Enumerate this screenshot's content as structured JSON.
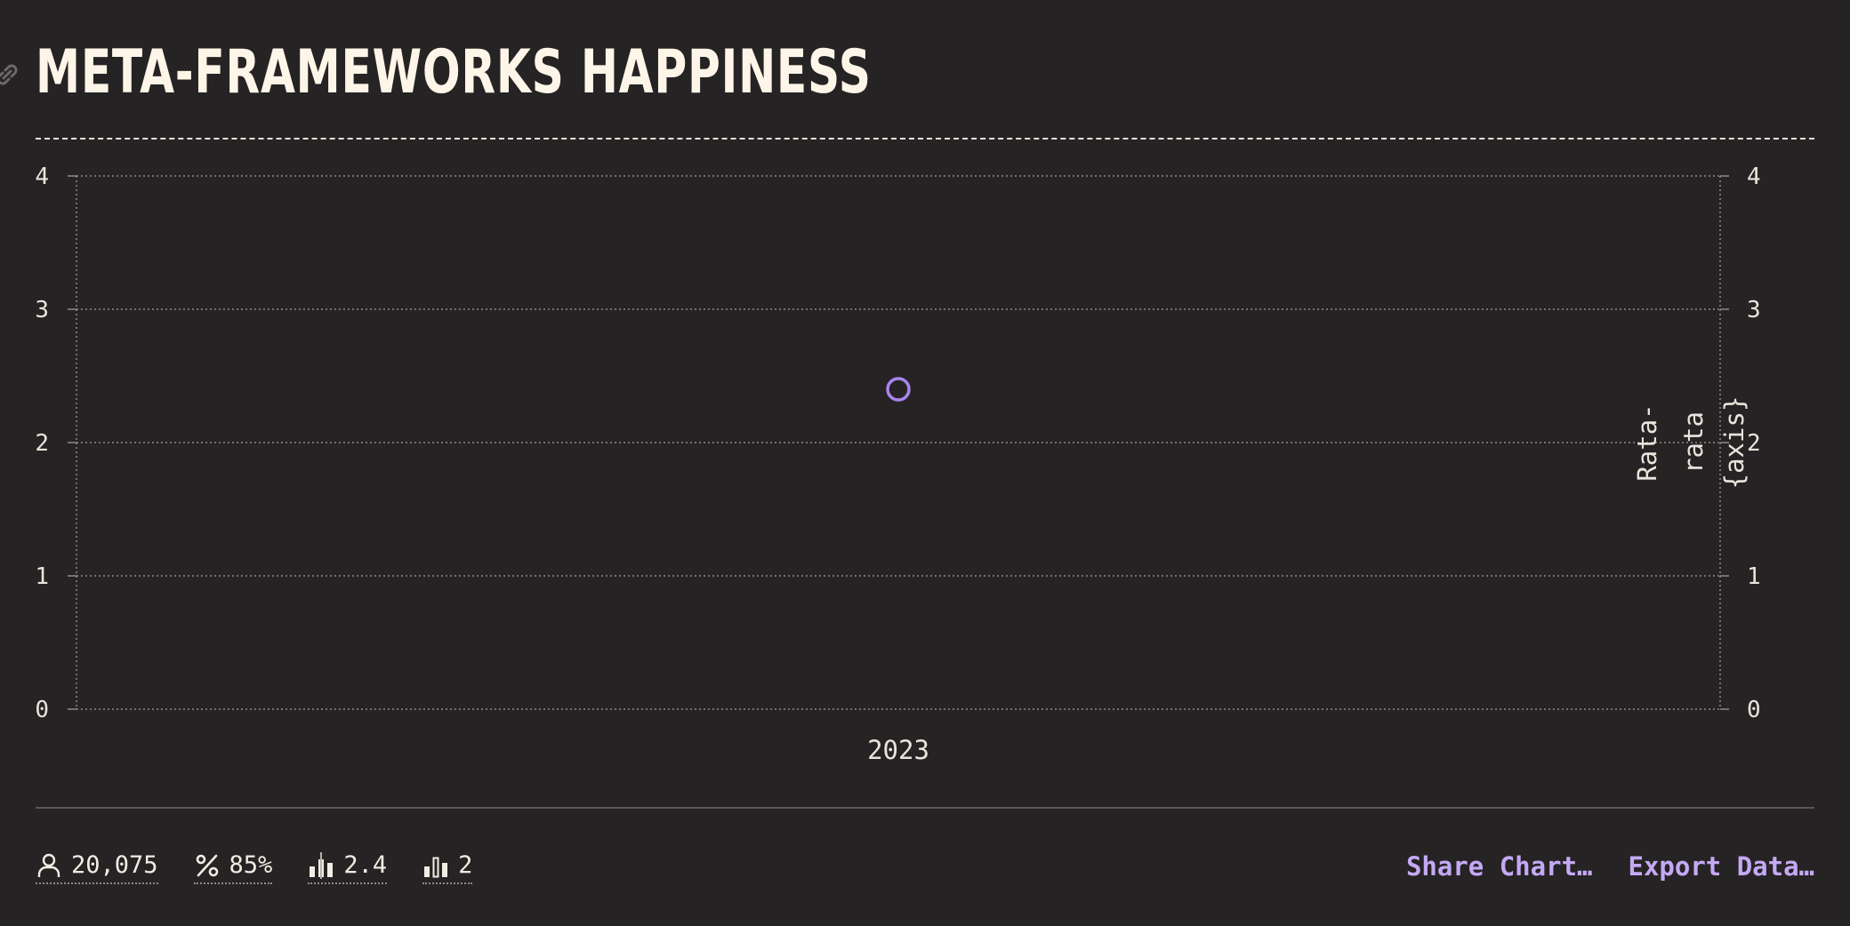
{
  "header": {
    "title": "META-FRAMEWORKS HAPPINESS"
  },
  "chart_data": {
    "type": "scatter",
    "categories": [
      "2023"
    ],
    "series": [
      {
        "values": [
          2.4
        ]
      }
    ],
    "ylim": [
      0,
      4
    ],
    "yticks": [
      0,
      1,
      2,
      3,
      4
    ],
    "y2label_lines": [
      "Rata-",
      "rata",
      "{axis}"
    ],
    "grid": true,
    "marker_color": "#a884f0"
  },
  "footer": {
    "stats": [
      {
        "icon": "user-icon",
        "value": "20,075"
      },
      {
        "icon": "percent-icon",
        "value": "85%"
      },
      {
        "icon": "average-bars-icon",
        "value": "2.4"
      },
      {
        "icon": "median-bars-icon",
        "value": "2"
      }
    ],
    "actions": {
      "share": "Share Chart…",
      "export": "Export Data…"
    }
  }
}
